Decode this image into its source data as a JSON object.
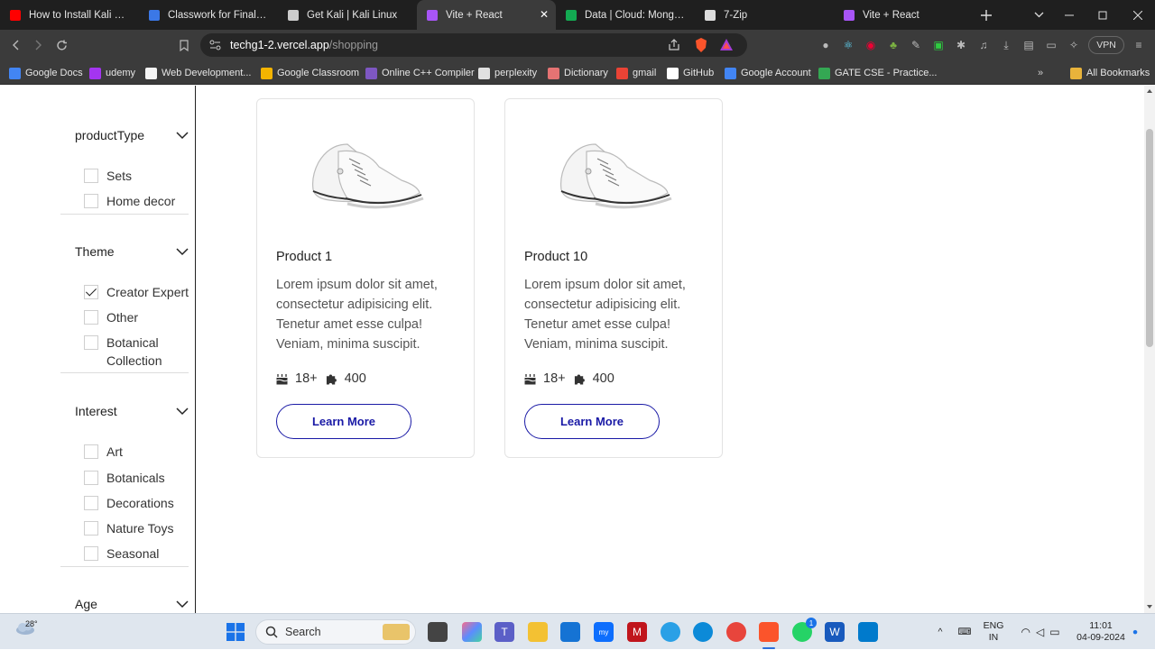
{
  "browser": {
    "tabs": [
      {
        "title": "How to Install Kali Linux in",
        "icon": "youtube-icon",
        "color": "#ff0000"
      },
      {
        "title": "Classwork for Final Year C",
        "icon": "classroom-icon",
        "color": "#3b78e7"
      },
      {
        "title": "Get Kali | Kali Linux",
        "icon": "kali-icon",
        "color": "#cccccc"
      },
      {
        "title": "Vite + React",
        "icon": "vite-icon",
        "color": "#a855f7",
        "active": true
      },
      {
        "title": "Data | Cloud: MongoDB C",
        "icon": "mongodb-icon",
        "color": "#13aa52"
      },
      {
        "title": "7-Zip",
        "icon": "7zip-icon",
        "color": "#dddddd"
      },
      {
        "title": "Vite + React",
        "icon": "vite-icon",
        "color": "#a855f7"
      }
    ],
    "url_host": "techg1-2.vercel.app",
    "url_path": "/shopping",
    "vpn_label": "VPN",
    "bookmarks": [
      {
        "label": "Google Docs",
        "color": "#4285f4"
      },
      {
        "label": "udemy",
        "color": "#a435f0"
      },
      {
        "label": "Web Development...",
        "color": "#f5f5f5"
      },
      {
        "label": "Google Classroom",
        "color": "#f4b400"
      },
      {
        "label": "Online C++ Compiler",
        "color": "#7e57c2"
      },
      {
        "label": "perplexity",
        "color": "#e0e0e0"
      },
      {
        "label": "Dictionary",
        "color": "#e57373"
      },
      {
        "label": "gmail",
        "color": "#ea4335"
      },
      {
        "label": "GitHub",
        "color": "#ffffff"
      },
      {
        "label": "Google Account",
        "color": "#4285f4"
      },
      {
        "label": "GATE CSE - Practice...",
        "color": "#34a853"
      }
    ],
    "all_bookmarks": "All Bookmarks"
  },
  "filters": [
    {
      "title": "productType",
      "options": [
        {
          "label": "Sets",
          "checked": false
        },
        {
          "label": "Home decor",
          "checked": false
        }
      ]
    },
    {
      "title": "Theme",
      "options": [
        {
          "label": "Creator Expert",
          "checked": true
        },
        {
          "label": "Other",
          "checked": false
        },
        {
          "label": "Botanical Collection",
          "checked": false
        }
      ]
    },
    {
      "title": "Interest",
      "options": [
        {
          "label": "Art",
          "checked": false
        },
        {
          "label": "Botanicals",
          "checked": false
        },
        {
          "label": "Decorations",
          "checked": false
        },
        {
          "label": "Nature Toys",
          "checked": false
        },
        {
          "label": "Seasonal",
          "checked": false
        }
      ]
    },
    {
      "title": "Age",
      "options": []
    }
  ],
  "products": [
    {
      "title": "Product 1",
      "description": "Lorem ipsum dolor sit amet, consectetur adipisicing elit. Tenetur amet esse culpa! Veniam, minima suscipit.",
      "age": "18+",
      "pieces": "400",
      "button": "Learn More"
    },
    {
      "title": "Product 10",
      "description": "Lorem ipsum dolor sit amet, consectetur adipisicing elit. Tenetur amet esse culpa! Veniam, minima suscipit.",
      "age": "18+",
      "pieces": "400",
      "button": "Learn More"
    }
  ],
  "taskbar": {
    "weather": "28°",
    "search_placeholder": "Search",
    "lang_top": "ENG",
    "lang_bottom": "IN",
    "time": "11:01",
    "date": "04-09-2024",
    "badge_whatsapp": "1"
  }
}
